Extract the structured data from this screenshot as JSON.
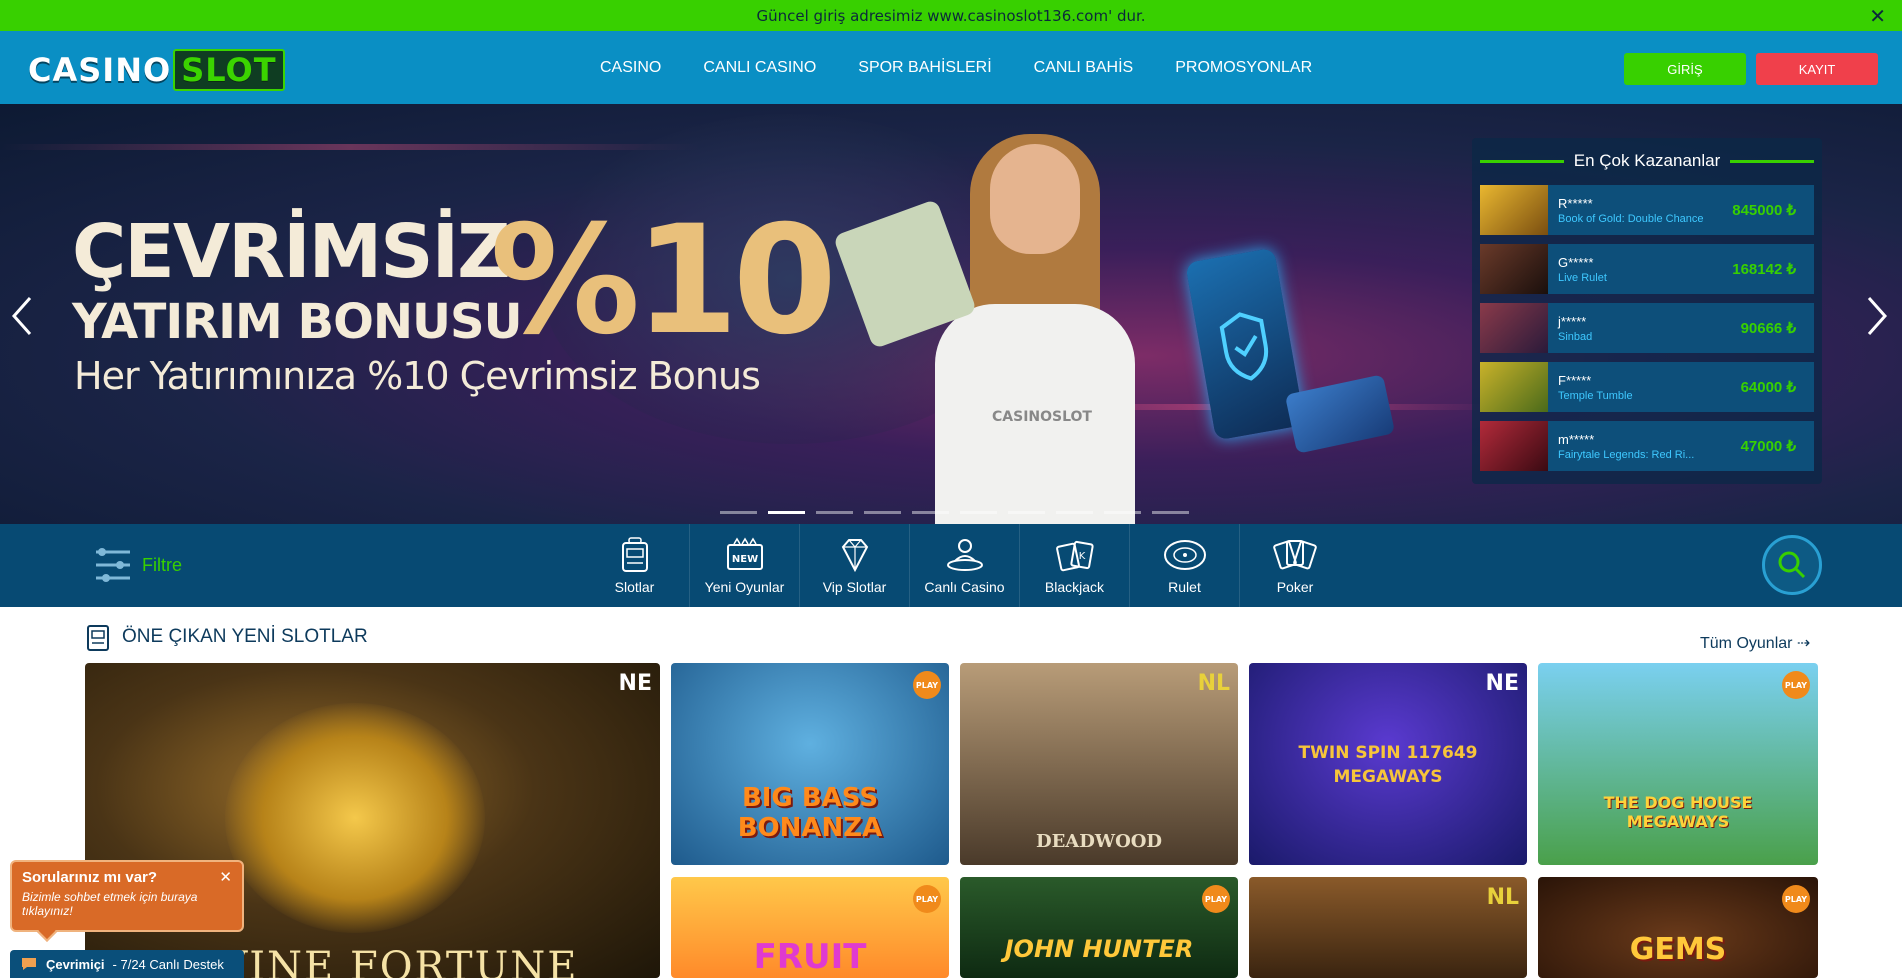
{
  "topbar": {
    "message": "Güncel giriş adresimiz www.casinoslot136.com' dur.",
    "close": "✕"
  },
  "header": {
    "logo_a": "CASINO",
    "logo_b": "SLOT",
    "nav": [
      "CASINO",
      "CANLI CASINO",
      "SPOR BAHİSLERİ",
      "CANLI BAHİS",
      "PROMOSYONLAR"
    ],
    "login": "GİRİŞ",
    "register": "KAYIT"
  },
  "hero": {
    "line1": "ÇEVRİMSİZ",
    "line2": "YATIRIM BONUSU",
    "percent": "%10",
    "sub": "Her Yatırımınıza %10 Çevrimsiz Bonus",
    "shirt_logo": "CASINOSLOT",
    "slides": 10,
    "active_slide": 2
  },
  "winners": {
    "title": "En Çok Kazananlar",
    "rows": [
      {
        "user": "R*****",
        "game": "Book of Gold: Double Chance",
        "amount": "845000 ₺",
        "thumb_color": "#b8841c"
      },
      {
        "user": "G*****",
        "game": "Live Rulet",
        "amount": "168142 ₺",
        "thumb_color": "#5a2a20"
      },
      {
        "user": "j*****",
        "game": "Sinbad",
        "amount": "90666 ₺",
        "thumb_color": "#6a2a3a"
      },
      {
        "user": "F*****",
        "game": "Temple Tumble",
        "amount": "64000 ₺",
        "thumb_color": "#7a8a22"
      },
      {
        "user": "m*****",
        "game": "Fairytale Legends: Red Ri...",
        "amount": "47000 ₺",
        "thumb_color": "#8a1f2a"
      }
    ]
  },
  "catbar": {
    "filter": "Filtre",
    "categories": [
      "Slotlar",
      "Yeni Oyunlar",
      "Vip Slotlar",
      "Canlı Casino",
      "Blackjack",
      "Rulet",
      "Poker"
    ]
  },
  "section": {
    "title": "ÖNE ÇIKAN YENİ SLOTLAR",
    "all_games": "Tüm Oyunlar ⇢"
  },
  "games": {
    "featured": {
      "title": "DIVINE FORTUNE",
      "badge": "NE"
    },
    "tiles": [
      {
        "title": "BIG BASS BONANZA",
        "badge": "PLAY"
      },
      {
        "title": "DEADWOOD",
        "badge": "NL"
      },
      {
        "title": "TWIN SPIN 117649 MEGAWAYS",
        "badge": "NE"
      },
      {
        "title": "THE DOG HOUSE MEGAWAYS",
        "badge": "PLAY"
      },
      {
        "title": "FRUIT",
        "badge": "PLAY"
      },
      {
        "title": "JOHN HUNTER",
        "badge": "PLAY"
      },
      {
        "title": "",
        "badge": "NL"
      },
      {
        "title": "GEMS",
        "badge": "PLAY"
      }
    ]
  },
  "chat": {
    "title": "Sorularınız mı var?",
    "desc": "Bizimle sohbet etmek için buraya tıklayınız!",
    "close": "✕",
    "status": "Çevrimiçi",
    "status_desc": "- 7/24 Canlı Destek"
  }
}
